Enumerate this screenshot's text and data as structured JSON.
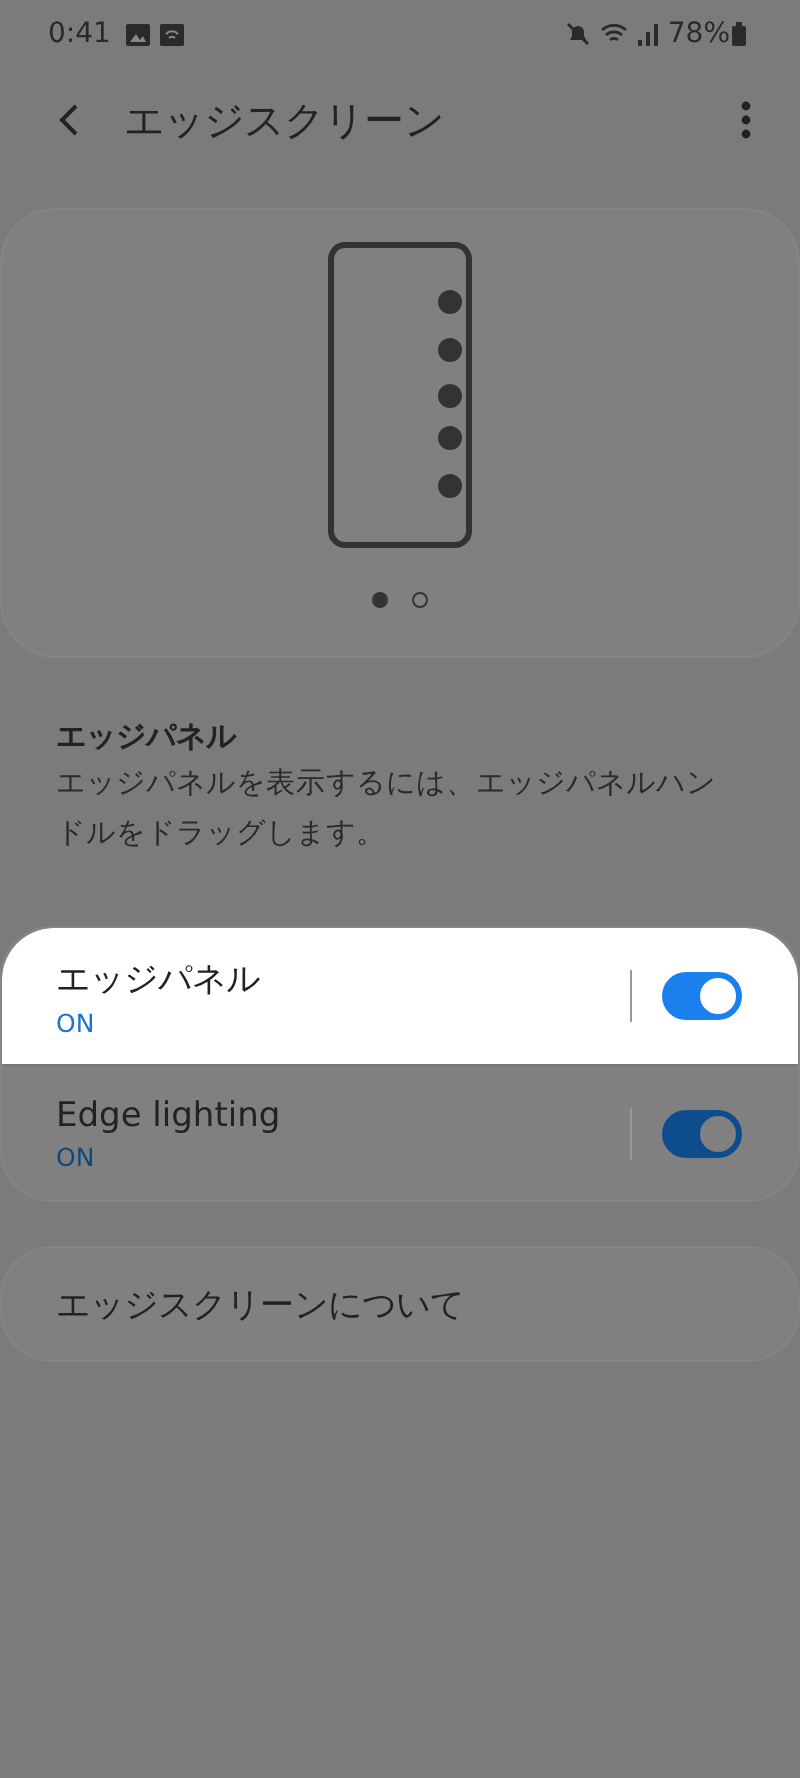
{
  "status_bar": {
    "time": "0:41",
    "battery": "78%"
  },
  "header": {
    "title": "エッジスクリーン"
  },
  "preview": {
    "pages": [
      {
        "selected": true
      },
      {
        "selected": false
      }
    ]
  },
  "section": {
    "title": "エッジパネル",
    "description": "エッジパネルを表示するには、エッジパネルハンドルをドラッグします。"
  },
  "settings": [
    {
      "label": "エッジパネル",
      "status": "ON",
      "on": true,
      "highlighted": true
    },
    {
      "label": "Edge lighting",
      "status": "ON",
      "on": true,
      "highlighted": false
    }
  ],
  "about": {
    "label": "エッジスクリーンについて"
  }
}
